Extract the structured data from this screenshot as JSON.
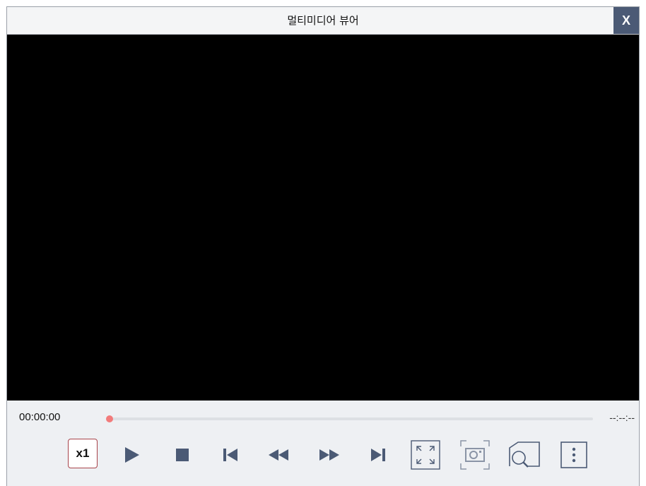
{
  "window": {
    "title": "멀티미디어 뷰어",
    "close_label": "X"
  },
  "playback": {
    "current_time": "00:00:00",
    "total_time": "--:--:--",
    "progress": 0
  },
  "controls": {
    "speed_label": "x1",
    "buttons": [
      "play-icon",
      "stop-icon",
      "skip-previous-icon",
      "rewind-icon",
      "fast-forward-icon",
      "skip-next-icon",
      "fullscreen-icon",
      "snapshot-icon",
      "zoom-search-icon",
      "more-options-icon"
    ]
  },
  "colors": {
    "icon": "#4b5a75",
    "close_bg": "#4b5a75",
    "seek_handle": "#f27b7b",
    "speed_border": "#a7434a"
  }
}
